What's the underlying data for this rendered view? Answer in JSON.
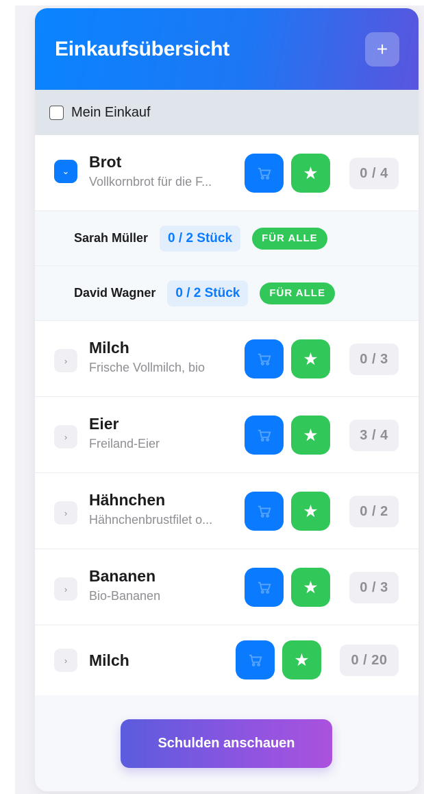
{
  "header": {
    "title": "Einkaufsübersicht",
    "add_label": "+"
  },
  "group": {
    "label": "Mein Einkauf",
    "checked": false
  },
  "items": [
    {
      "name": "Brot",
      "description": "Vollkornbrot für die F...",
      "count": "0 / 4",
      "expanded": true
    },
    {
      "name": "Milch",
      "description": "Frische Vollmilch, bio",
      "count": "0 / 3",
      "expanded": false
    },
    {
      "name": "Eier",
      "description": "Freiland-Eier",
      "count": "3 / 4",
      "expanded": false
    },
    {
      "name": "Hähnchen",
      "description": "Hähnchenbrustfilet o...",
      "count": "0 / 2",
      "expanded": false
    },
    {
      "name": "Bananen",
      "description": "Bio-Bananen",
      "count": "0 / 3",
      "expanded": false
    },
    {
      "name": "Milch",
      "description": "",
      "count": "0 / 20",
      "expanded": false
    }
  ],
  "persons": [
    {
      "name": "Sarah Müller",
      "quantity": "0 / 2 Stück",
      "tag": "FÜR ALLE"
    },
    {
      "name": "David Wagner",
      "quantity": "0 / 2 Stück",
      "tag": "FÜR ALLE"
    }
  ],
  "icons": {
    "cart": "cart-icon",
    "star": "★",
    "chevron_open": "⌄",
    "chevron_closed": "›"
  },
  "footer": {
    "button_label": "Schulden anschauen"
  },
  "colors": {
    "primary": "#0a7aff",
    "success": "#31c759",
    "accent": "#8a55e0"
  }
}
